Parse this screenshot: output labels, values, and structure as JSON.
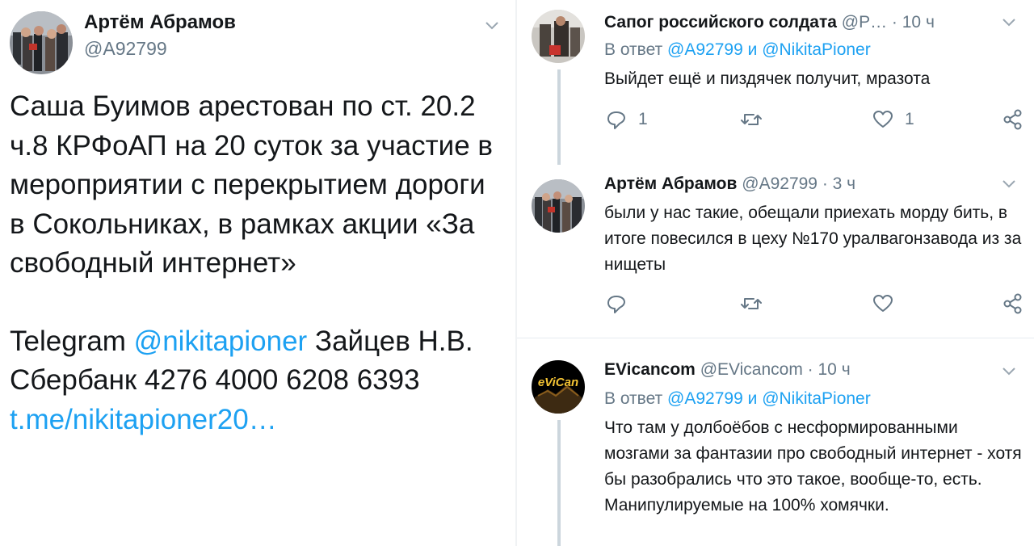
{
  "main_tweet": {
    "author_name": "Артём Абрамов",
    "author_handle": "@A92799",
    "text_part1": "Саша Буимов арестован по ст. 20.2 ч.8 КРФоАП на 20 суток за участие в мероприятии с перекрытием дороги в Сокольниках, в рамках акции «За свободный интернет»",
    "telegram_prefix": "Telegram ",
    "telegram_link": "@nikitapioner",
    "telegram_suffix": " Зайцев Н.В.",
    "sberbank_line": "Сбербанк 4276 4000 6208 6393",
    "url_link": "t.me/nikitapioner20…"
  },
  "replies": [
    {
      "author_name": "Сапог российского солдата",
      "meta": "@P… · 10 ч",
      "reply_prefix": "В ответ ",
      "reply_to_1": "@A92799",
      "reply_and": " и ",
      "reply_to_2": "@NikitaPioner",
      "text": "Выйдет ещё и пиздячек получит, мразота",
      "reply_count": "1",
      "retweet_count": "",
      "like_count": "1"
    },
    {
      "author_name": "Артём Абрамов",
      "meta": "@A92799 · 3 ч",
      "text": "были у нас такие, обещали приехать морду бить, в итоге повесился в цеху №170 уралвагонзавода из за нищеты",
      "reply_count": "",
      "retweet_count": "",
      "like_count": ""
    },
    {
      "author_name": "EVicancom",
      "meta": "@EVicancom · 10 ч",
      "reply_prefix": "В ответ ",
      "reply_to_1": "@A92799",
      "reply_and": " и ",
      "reply_to_2": "@NikitaPioner",
      "text": "Что там у долбоёбов с несформированными мозгами за фантазии про свободный интернет - хотя бы разобрались что это такое, вообще-то, есть. Манипулируемые на 100% хомячки.",
      "avatar_logo_text": "eViCan"
    }
  ],
  "colors": {
    "text": "#14171a",
    "secondary": "#657786",
    "link": "#1da1f2",
    "thread_line": "#ccd6dd"
  },
  "icons": {
    "reply": "speech-bubble-icon",
    "retweet": "retweet-icon",
    "like": "heart-icon",
    "share": "share-icon",
    "menu": "chevron-down-icon"
  }
}
